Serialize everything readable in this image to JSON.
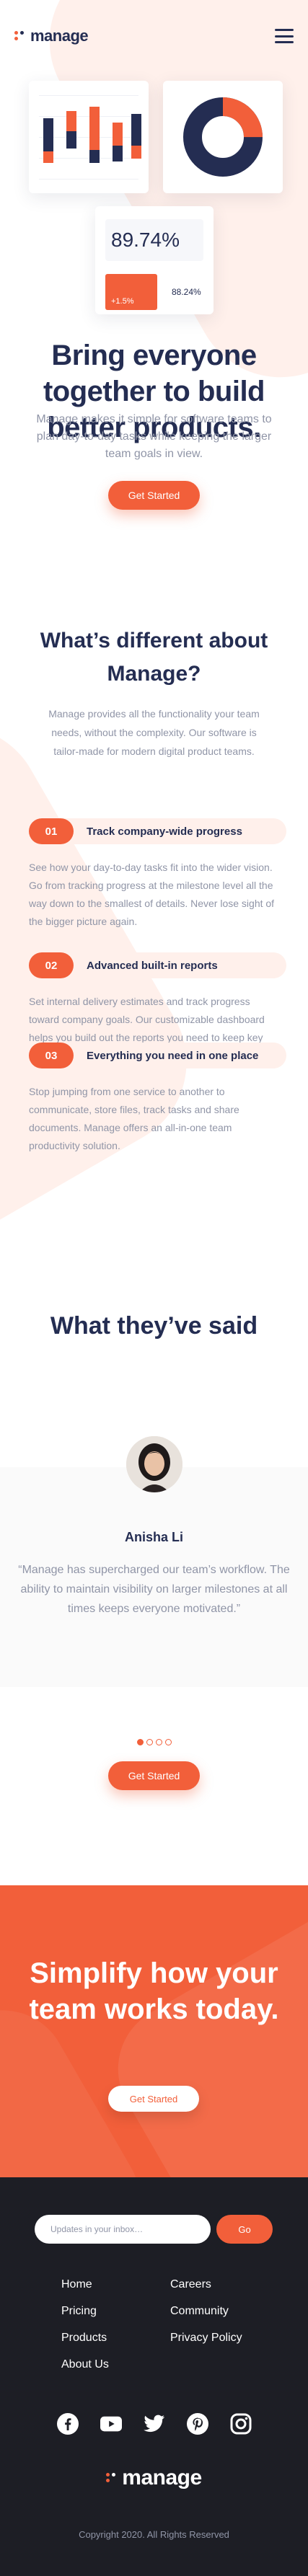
{
  "brand": {
    "name": "manage",
    "accent": "#F25F3A",
    "navy": "#242D52",
    "muted": "#9095A7",
    "pale": "#FFF0EB",
    "footer_bg": "#1D1E25"
  },
  "header": {
    "menu_icon": "hamburger-icon"
  },
  "hero_card": {
    "stat_value": "89.74%",
    "stat_delta": "+1.5%",
    "stat_secondary": "88.24%"
  },
  "hero": {
    "title": "Bring everyone together to build better products.",
    "subtitle": "Manage makes it simple for software teams to plan day-to-day tasks while keeping the larger team goals in view.",
    "cta_label": "Get Started"
  },
  "different": {
    "title": "What’s different about Manage?",
    "subtitle": "Manage provides all the functionality your team needs, without the complexity. Our software is tailor-made for modern digital product teams.",
    "features": [
      {
        "number": "01",
        "title": "Track company-wide progress",
        "text": "See how your day-to-day tasks fit into the wider vision. Go from tracking progress at the milestone level all the way down to the smallest of details. Never lose sight of the bigger picture again."
      },
      {
        "number": "02",
        "title": "Advanced built-in reports",
        "text": "Set internal delivery estimates and track progress toward company goals. Our customizable dashboard helps you build out the reports you need to keep key stakeholders informed."
      },
      {
        "number": "03",
        "title": "Everything you need in one place",
        "text": "Stop jumping from one service to another to communicate, store files, track tasks and share documents. Manage offers an all-in-one team productivity solution."
      }
    ]
  },
  "testimonials": {
    "title": "What they’ve said",
    "name": "Anisha Li",
    "quote": "“Manage has supercharged our team’s workflow. The ability to maintain visibility on larger milestones at all times keeps everyone motivated.”",
    "slide_count": 4,
    "active_slide": 1,
    "cta_label": "Get Started"
  },
  "cta": {
    "title": "Simplify how your team works today.",
    "button_label": "Get Started"
  },
  "footer": {
    "newsletter_placeholder": "Updates in your inbox…",
    "go_label": "Go",
    "links_left": [
      "Home",
      "Pricing",
      "Products",
      "About Us"
    ],
    "links_right": [
      "Careers",
      "Community",
      "Privacy Policy"
    ],
    "socials": [
      "facebook-icon",
      "youtube-icon",
      "twitter-icon",
      "pinterest-icon",
      "instagram-icon"
    ],
    "copyright": "Copyright 2020. All Rights Reserved"
  }
}
